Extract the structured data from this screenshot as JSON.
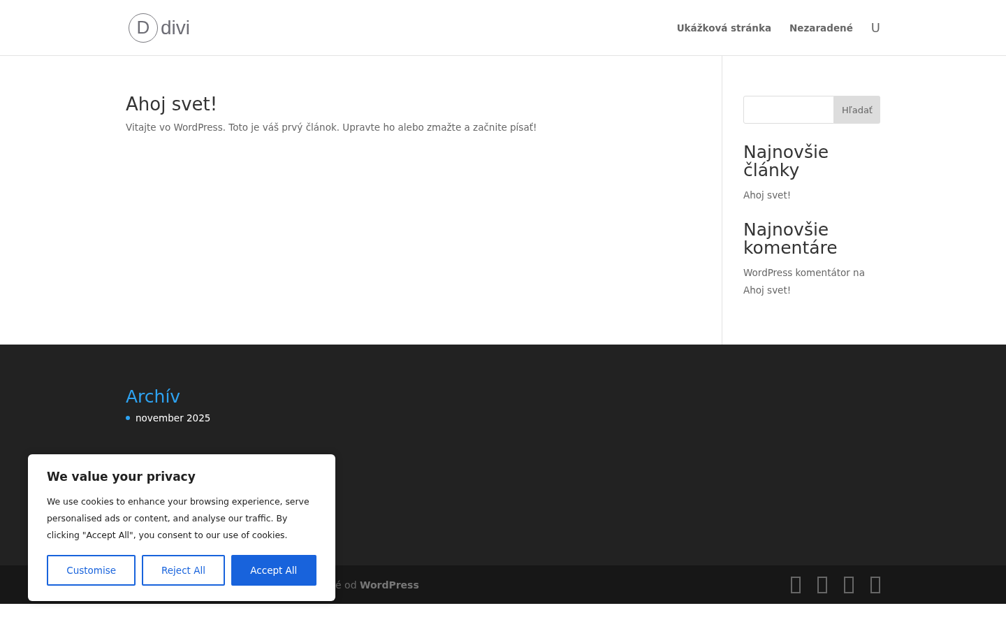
{
  "header": {
    "logo_text": "divi",
    "logo_letter": "D",
    "nav": [
      {
        "label": "Ukážková stránka"
      },
      {
        "label": "Nezaradené"
      }
    ],
    "nav_glyph": "U"
  },
  "post": {
    "title": "Ahoj svet!",
    "excerpt": "Vitajte vo WordPress. Toto je váš prvý článok. Upravte ho alebo zmažte a začnite písať!"
  },
  "sidebar": {
    "search_button": "Hľadať",
    "widgets": [
      {
        "title": "Najnovšie články",
        "items": [
          "Ahoj svet!"
        ]
      },
      {
        "title": "Najnovšie komentáre",
        "items": [
          "WordPress komentátor na Ahoj svet!"
        ]
      }
    ]
  },
  "footer": {
    "widget_title": "Archív",
    "items": [
      "november 2025"
    ],
    "credit": "é od **WordPress**"
  },
  "cookie_banner": {
    "title": "We value your privacy",
    "text": "We use cookies to enhance your browsing experience, serve personalised ads or content, and analyse our traffic. By clicking \"Accept All\", you consent to our use of cookies.",
    "buttons": [
      {
        "label": "Customise",
        "kind": "outline"
      },
      {
        "label": "Reject All",
        "kind": "outline"
      },
      {
        "label": "Accept All",
        "kind": "primary"
      }
    ]
  }
}
